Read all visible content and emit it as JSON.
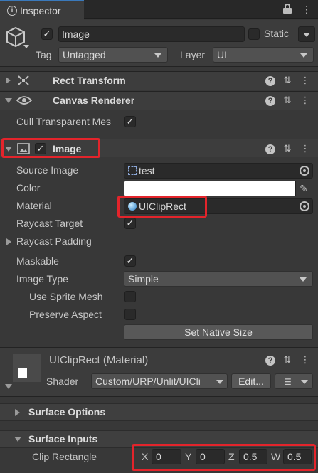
{
  "tab": {
    "title": "Inspector"
  },
  "object": {
    "name": "Image",
    "active": true,
    "static_label": "Static",
    "tag_label": "Tag",
    "tag_value": "Untagged",
    "layer_label": "Layer",
    "layer_value": "UI"
  },
  "components": {
    "rect_transform": {
      "title": "Rect Transform"
    },
    "canvas_renderer": {
      "title": "Canvas Renderer",
      "cull_label": "Cull Transparent Mes",
      "cull_checked": true
    },
    "image": {
      "title": "Image",
      "enabled": true,
      "source_image_label": "Source Image",
      "source_image_value": "test",
      "color_label": "Color",
      "color_value": "#ffffff",
      "material_label": "Material",
      "material_value": "UIClipRect",
      "raycast_target_label": "Raycast Target",
      "raycast_target": true,
      "raycast_padding_label": "Raycast Padding",
      "maskable_label": "Maskable",
      "maskable": true,
      "image_type_label": "Image Type",
      "image_type_value": "Simple",
      "use_sprite_mesh_label": "Use Sprite Mesh",
      "use_sprite_mesh": false,
      "preserve_aspect_label": "Preserve Aspect",
      "preserve_aspect": false,
      "set_native_size_label": "Set Native Size"
    }
  },
  "material": {
    "title": "UIClipRect (Material)",
    "shader_label": "Shader",
    "shader_value": "Custom/URP/Unlit/UICli",
    "edit_label": "Edit...",
    "surface_options_label": "Surface Options",
    "surface_inputs_label": "Surface Inputs",
    "clip_rect_label": "Clip Rectangle",
    "clip": {
      "x_label": "X",
      "x": "0",
      "y_label": "Y",
      "y": "0",
      "z_label": "Z",
      "z": "0.5",
      "w_label": "W",
      "w": "0.5"
    }
  },
  "colors": {
    "highlight": "#e3242b",
    "accent": "#3a79bb"
  }
}
